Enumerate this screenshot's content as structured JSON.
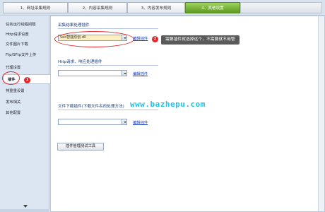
{
  "steps": [
    {
      "label": "1、网址采集规则"
    },
    {
      "label": "2、内容采集规则"
    },
    {
      "label": "3、内容发布规则"
    },
    {
      "label": "4、其他设置"
    }
  ],
  "sidebar": {
    "items": [
      {
        "label": "任务运行线程间隔"
      },
      {
        "label": "Http请求设置"
      },
      {
        "label": "文件图片下载"
      },
      {
        "label": "Ftp/SFtp文件上传"
      },
      {
        "label": "代理设置"
      },
      {
        "label": "插件"
      },
      {
        "label": "排重重设置"
      },
      {
        "label": "发布相关"
      },
      {
        "label": "其他配置"
      }
    ],
    "active_index": 5
  },
  "main": {
    "plugin1": {
      "title": "采集结果处理插件",
      "selected": "Seo智能原创.dll",
      "edit_link": "编辑插件"
    },
    "plugin2": {
      "title": "Http请求、响应处理插件",
      "selected": "",
      "edit_link": "编辑插件"
    },
    "plugin3": {
      "title": "文件下载插件(下载文件名的处理方法)",
      "selected": "",
      "edit_link": "编辑插件"
    },
    "test_button": "插件管理测试工具"
  },
  "annotations": {
    "badge1": "1",
    "badge2": "2",
    "tip": "需要插件就选择这个，不需要就不用管",
    "watermark": "www.bazhepu.com",
    "accent_color": "#e3262a"
  }
}
